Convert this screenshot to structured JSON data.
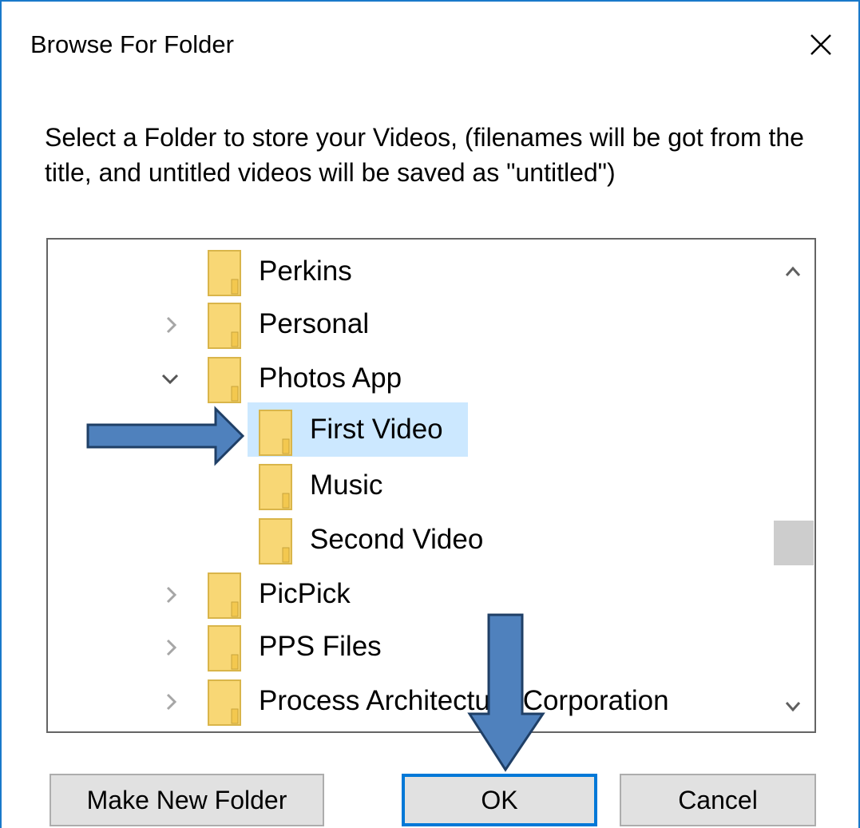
{
  "window": {
    "title": "Browse For Folder"
  },
  "description": "Select a Folder to store your Videos, (filenames will be got from the title, and untitled videos will be saved as \"untitled\")",
  "tree": {
    "items": [
      {
        "label": "Perkins",
        "expander": "none"
      },
      {
        "label": "Personal",
        "expander": "collapsed"
      },
      {
        "label": "Photos App",
        "expander": "expanded"
      },
      {
        "label": "First Video",
        "expander": "none",
        "selected": true
      },
      {
        "label": "Music",
        "expander": "none"
      },
      {
        "label": "Second Video",
        "expander": "none"
      },
      {
        "label": "PicPick",
        "expander": "collapsed"
      },
      {
        "label": "PPS Files",
        "expander": "collapsed"
      },
      {
        "label": "Process Architecture Corporation",
        "expander": "collapsed"
      }
    ]
  },
  "buttons": {
    "make_new_folder": "Make New Folder",
    "ok": "OK",
    "cancel": "Cancel"
  },
  "colors": {
    "accent": "#0078d7",
    "window_border": "#1979ca",
    "selection": "#cce8ff",
    "folder": "#f8d775",
    "arrow_fill": "#4f81bd",
    "arrow_stroke": "#1f3f66"
  },
  "icons": [
    "close-icon",
    "folder-icon",
    "chevron-right-icon",
    "chevron-down-icon",
    "scroll-up-icon",
    "scroll-down-icon",
    "callout-arrow"
  ]
}
